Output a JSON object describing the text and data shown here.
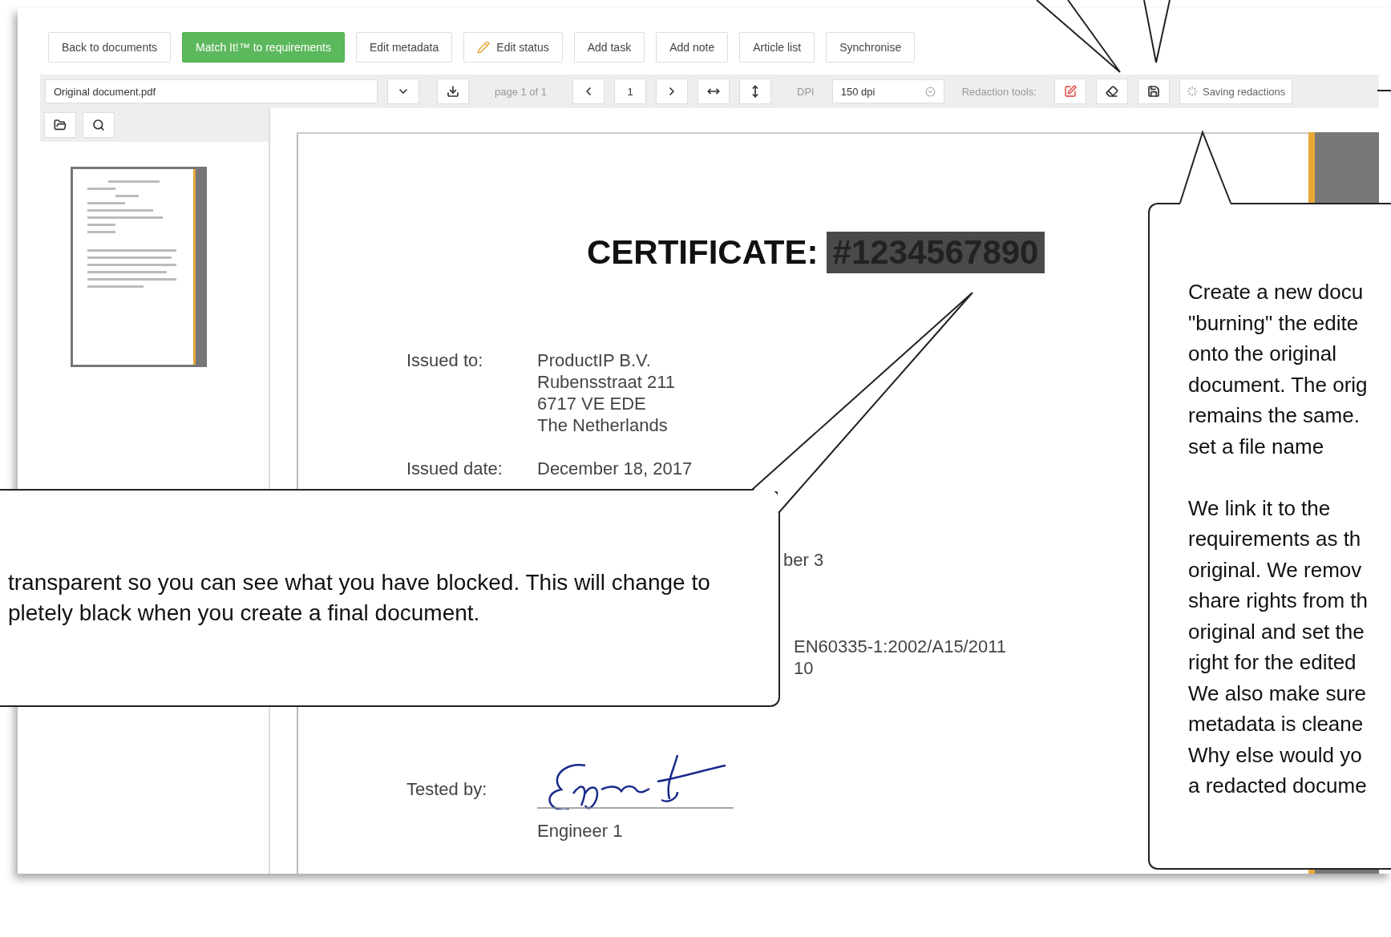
{
  "toolbar": {
    "buttons": [
      {
        "label": "Back to documents",
        "kind": "plain"
      },
      {
        "label": "Match It!™ to requirements",
        "kind": "primary"
      },
      {
        "label": "Edit metadata",
        "kind": "plain"
      },
      {
        "label": "Edit status",
        "kind": "status"
      },
      {
        "label": "Add task",
        "kind": "plain"
      },
      {
        "label": "Add note",
        "kind": "plain"
      },
      {
        "label": "Article list",
        "kind": "plain"
      },
      {
        "label": "Synchronise",
        "kind": "plain"
      }
    ]
  },
  "viewer_bar": {
    "file": "Original document.pdf",
    "page_info": "page 1 of 1",
    "page": "1",
    "dpi_label": "DPI",
    "dpi": "150 dpi",
    "redaction_label": "Redaction tools:",
    "save_status": "Saving redactions"
  },
  "document": {
    "title": "CERTIFICATE:",
    "redacted_number": "#1234567890",
    "fields": [
      {
        "label": "Issued to:",
        "value": "ProductIP B.V.\nRubensstraat 211\n6717 VE  EDE\nThe Netherlands"
      },
      {
        "label": "Issued date:",
        "value": "December 18, 2017"
      }
    ],
    "fragments": [
      "ber 3",
      "EN60335-1:2002/A15/2011\n10"
    ],
    "signature": {
      "label": "Tested by:",
      "name": "Engineer 1"
    }
  },
  "callouts": [
    {
      "text": "transparent so you can see what you have blocked. This will change to\npletely black when you create a final document."
    },
    {
      "text": "Create a new docu\n\"burning\" the edite\nonto the original\ndocument. The orig\nremains the same.\nset a file name\n\nWe link it to the\nrequirements as th\noriginal. We remov\nshare rights from th\noriginal and set the\nright for the edited\nWe also make sure\nmetadata is cleane\nWhy else would yo\na redacted docume"
    }
  ]
}
